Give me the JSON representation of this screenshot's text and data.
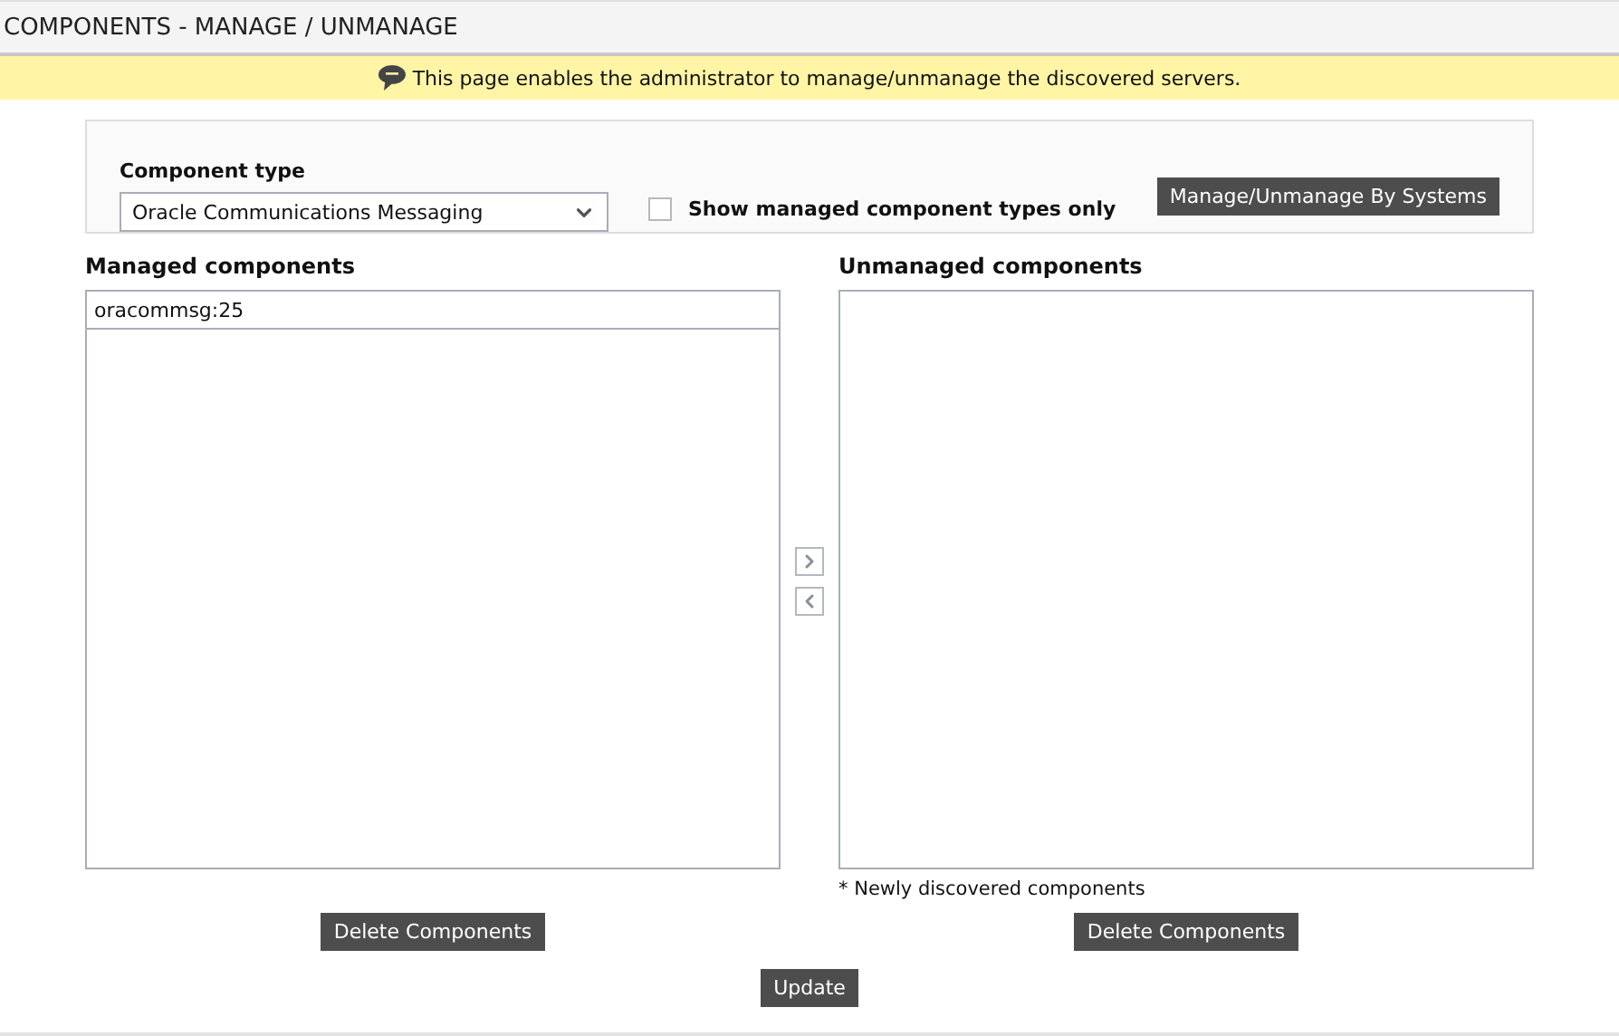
{
  "page_title": "COMPONENTS - MANAGE / UNMANAGE",
  "notice": "This page enables the administrator to manage/unmanage the discovered servers.",
  "filter": {
    "label": "Component type",
    "value": "Oracle Communications Messaging",
    "checkbox": {
      "label": "Show managed component types only",
      "checked": false
    },
    "button": "Manage/Unmanage By Systems"
  },
  "managed": {
    "title": "Managed components",
    "items": [
      {
        "label": "oracommsg:25",
        "selected": false
      }
    ],
    "delete_button": "Delete Components"
  },
  "unmanaged": {
    "title": "Unmanaged components",
    "note": "* Newly discovered components",
    "delete_button": "Delete Components"
  },
  "update_button": "Update"
}
